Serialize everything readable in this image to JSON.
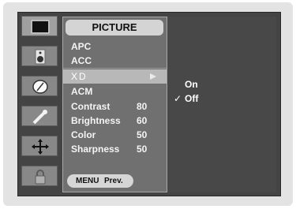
{
  "sidebar": {
    "icons": [
      {
        "name": "picture-icon"
      },
      {
        "name": "sound-icon"
      },
      {
        "name": "time-icon"
      },
      {
        "name": "setup-icon"
      },
      {
        "name": "option-icon"
      },
      {
        "name": "lock-icon"
      }
    ]
  },
  "menu": {
    "title": "PICTURE",
    "items": [
      {
        "label": "APC",
        "value": ""
      },
      {
        "label": "ACC",
        "value": ""
      },
      {
        "label": "XD",
        "value": ""
      },
      {
        "label": "ACM",
        "value": ""
      },
      {
        "label": "Contrast",
        "value": "80"
      },
      {
        "label": "Brightness",
        "value": "60"
      },
      {
        "label": "Color",
        "value": "50"
      },
      {
        "label": "Sharpness",
        "value": "50"
      }
    ],
    "selected_index": 2,
    "footer": {
      "key": "MENU",
      "action": "Prev."
    }
  },
  "submenu": {
    "options": [
      {
        "label": "On",
        "check": ""
      },
      {
        "label": "Off",
        "check": "✓"
      }
    ],
    "selected": "Off"
  },
  "colors": {
    "panel": "#444444",
    "menu_bg": "#707070",
    "highlight": "#b8b8b8",
    "title_bg": "#d4d4d4"
  }
}
